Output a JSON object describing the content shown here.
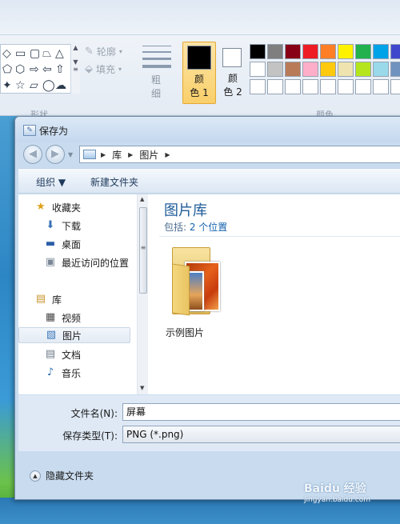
{
  "ribbon": {
    "outline_label": "轮廓",
    "fill_label": "填充",
    "thickness_label": "粗\n细",
    "color1_label": "颜\n色 1",
    "color2_label": "颜\n色 2",
    "shapes_caption": "形状",
    "colors_caption": "颜色",
    "color1_value": "#000000",
    "color2_value": "#ffffff",
    "palette_row1": [
      "#000000",
      "#7f7f7f",
      "#880015",
      "#ed1c24",
      "#ff7f27",
      "#fff200",
      "#22b14c",
      "#00a2e8",
      "#3f48cc"
    ],
    "palette_row2": [
      "#ffffff",
      "#c3c3c3",
      "#b97a57",
      "#ffaec9",
      "#ffc90e",
      "#efe4b0",
      "#b5e61d",
      "#99d9ea",
      "#7092be"
    ],
    "palette_row3": [
      "#ffffff",
      "#ffffff",
      "#ffffff",
      "#ffffff",
      "#ffffff",
      "#ffffff",
      "#ffffff",
      "#ffffff",
      "#ffffff"
    ]
  },
  "dialog": {
    "title": "保存为",
    "breadcrumb": [
      "库",
      "图片"
    ],
    "toolbar": {
      "organize": "组织 ▼",
      "new_folder": "新建文件夹"
    },
    "nav": {
      "favorites": "收藏夹",
      "downloads": "下载",
      "desktop": "桌面",
      "recent": "最近访问的位置",
      "libraries": "库",
      "videos": "视频",
      "pictures": "图片",
      "documents": "文档",
      "music": "音乐"
    },
    "library": {
      "title": "图片库",
      "includes_prefix": "包括: ",
      "includes_link": "2 个位置",
      "folder_name": "示例图片"
    },
    "filename_label": "文件名(N):",
    "filename_value": "屏幕",
    "filetype_label": "保存类型(T):",
    "filetype_value": "PNG (*.png)",
    "hide_folders": "隐藏文件夹"
  },
  "watermark": {
    "brand": "Baidu 经验",
    "url": "jingyan.baidu.com"
  }
}
